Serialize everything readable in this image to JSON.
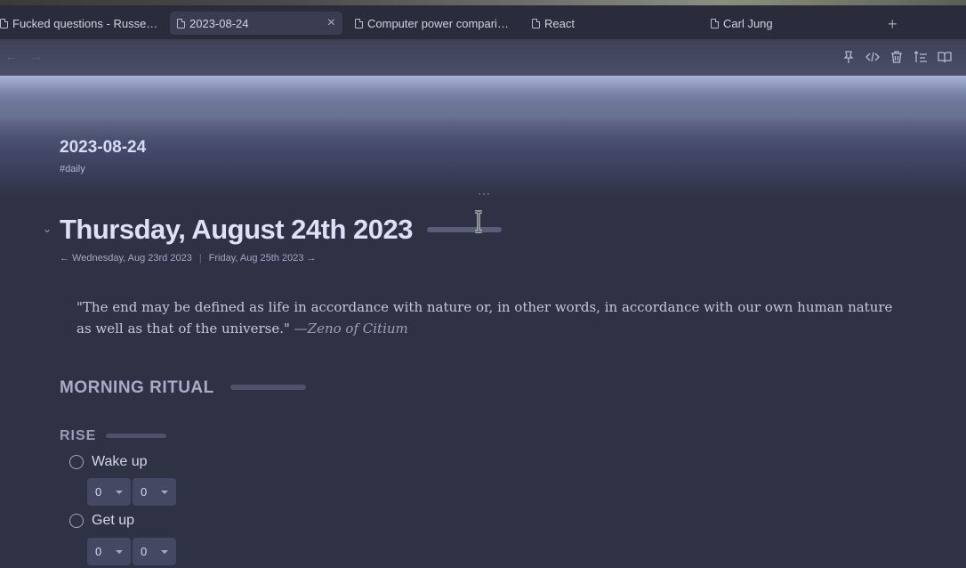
{
  "tabs": [
    {
      "label": "Fucked questions - Russe…",
      "icon": "document-icon"
    },
    {
      "label": "2023-08-24",
      "icon": "document-icon",
      "active": true
    },
    {
      "label": "Computer power compari…",
      "icon": "document-icon"
    },
    {
      "label": "React",
      "icon": "document-icon"
    },
    {
      "label": "Carl Jung",
      "icon": "book-icon"
    }
  ],
  "tab_close_symbol": "×",
  "new_tab_symbol": "+",
  "nav": {
    "back": "←",
    "forward": "→"
  },
  "toolbar": [
    "pin-icon",
    "code-icon",
    "trash-icon",
    "outline-icon",
    "reading-view-icon"
  ],
  "note": {
    "title": "2023-08-24",
    "tag": "#daily",
    "more": "···"
  },
  "heading": {
    "title": "Thursday, August 24th 2023",
    "prev_day": "← Wednesday, Aug 23rd 2023",
    "separator": "|",
    "next_day": "Friday, Aug 25th 2023 →"
  },
  "quote": {
    "text": "\"The end may be defined as life in accordance with nature or, in other words, in accordance with our own human nature as well as that of the universe.\" ",
    "author": "—Zeno of Citium"
  },
  "section": {
    "title": "MORNING RITUAL"
  },
  "subsection": {
    "title": "RISE"
  },
  "tasks": [
    {
      "label": "Wake up",
      "hour": "0",
      "minute": "0"
    },
    {
      "label": "Get up",
      "hour": "0",
      "minute": "0"
    }
  ],
  "colors": {
    "background": "#2f3144",
    "tabbar": "#2a2c3c",
    "heading": "#dde0f6"
  }
}
